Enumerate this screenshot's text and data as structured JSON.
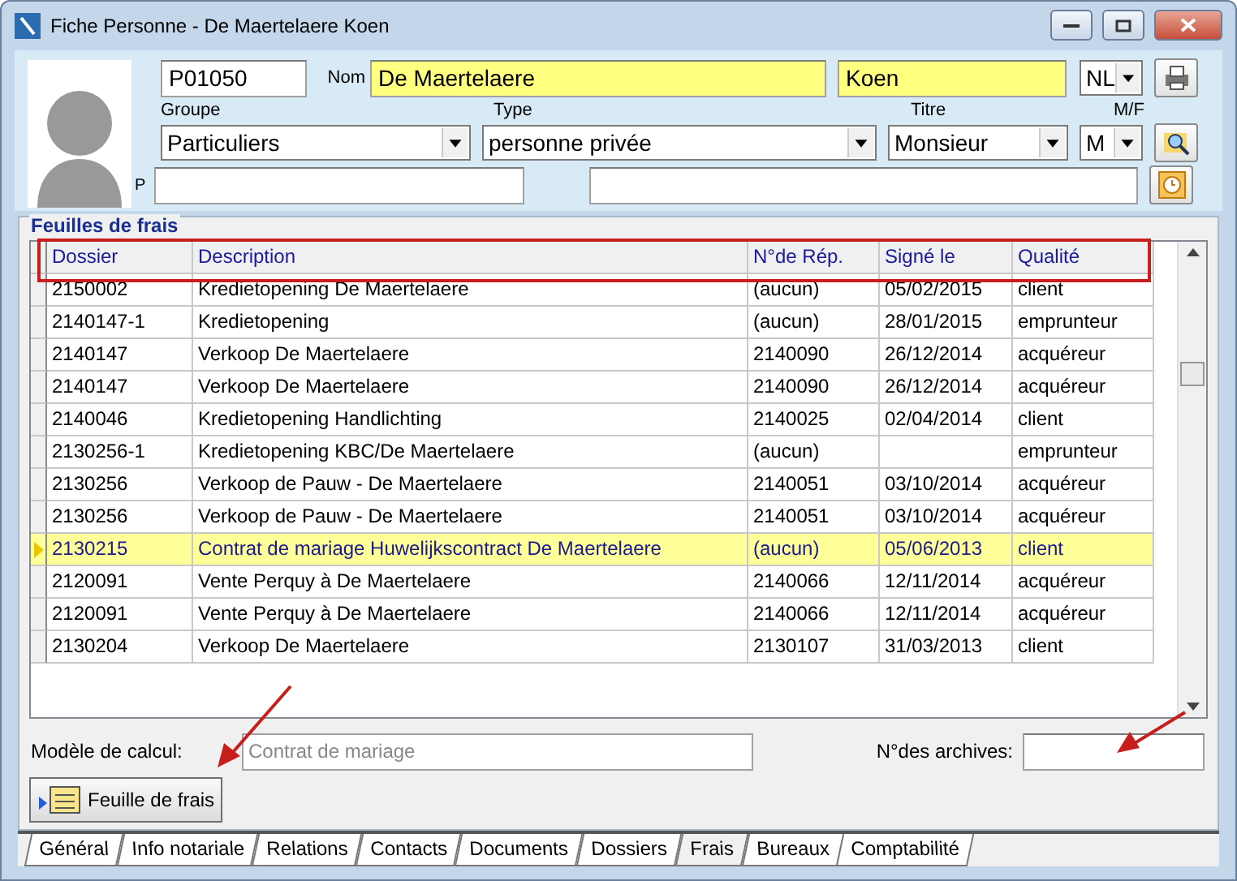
{
  "window": {
    "title": "Fiche Personne - De Maertelaere Koen"
  },
  "person": {
    "id": "P01050",
    "name_label": "Nom",
    "last_name": "De Maertelaere",
    "first_name": "Koen",
    "language": "NL",
    "group_label": "Groupe",
    "group": "Particuliers",
    "type_label": "Type",
    "type": "personne privée",
    "title_label": "Titre",
    "title": "Monsieur",
    "sex_label": "M/F",
    "sex": "M",
    "p_label": "P"
  },
  "expenses": {
    "title": "Feuilles de frais",
    "columns": [
      "Dossier",
      "Description",
      "N°de Rép.",
      "Signé le",
      "Qualité"
    ],
    "rows": [
      {
        "cells": [
          "2150002",
          "Kredietopening De Maertelaere",
          "(aucun)",
          "05/02/2015",
          "client"
        ],
        "selected": false
      },
      {
        "cells": [
          "2140147-1",
          "Kredietopening",
          "(aucun)",
          "28/01/2015",
          "emprunteur"
        ],
        "selected": false
      },
      {
        "cells": [
          "2140147",
          "Verkoop De Maertelaere",
          "2140090",
          "26/12/2014",
          "acquéreur"
        ],
        "selected": false
      },
      {
        "cells": [
          "2140147",
          "Verkoop De Maertelaere",
          "2140090",
          "26/12/2014",
          "acquéreur"
        ],
        "selected": false
      },
      {
        "cells": [
          "2140046",
          "Kredietopening Handlichting",
          "2140025",
          "02/04/2014",
          "client"
        ],
        "selected": false
      },
      {
        "cells": [
          "2130256-1",
          "Kredietopening KBC/De Maertelaere",
          "(aucun)",
          "",
          "emprunteur"
        ],
        "selected": false
      },
      {
        "cells": [
          "2130256",
          "Verkoop de Pauw - De Maertelaere",
          "2140051",
          "03/10/2014",
          "acquéreur"
        ],
        "selected": false
      },
      {
        "cells": [
          "2130256",
          "Verkoop de Pauw - De Maertelaere",
          "2140051",
          "03/10/2014",
          "acquéreur"
        ],
        "selected": false
      },
      {
        "cells": [
          "2130215",
          "Contrat de mariage Huwelijkscontract De Maertelaere",
          "(aucun)",
          "05/06/2013",
          "client"
        ],
        "selected": true
      },
      {
        "cells": [
          "2120091",
          "Vente Perquy à De Maertelaere",
          "2140066",
          "12/11/2014",
          "acquéreur"
        ],
        "selected": false
      },
      {
        "cells": [
          "2120091",
          "Vente Perquy à De Maertelaere",
          "2140066",
          "12/11/2014",
          "acquéreur"
        ],
        "selected": false
      },
      {
        "cells": [
          "2130204",
          "Verkoop De Maertelaere",
          "2130107",
          "31/03/2013",
          "client"
        ],
        "selected": false
      }
    ],
    "model_label": "Modèle de calcul:",
    "model": "Contrat de mariage",
    "model_disabled": true,
    "archives_label": "N°des archives:",
    "button": "Feuille de frais"
  },
  "tabs": [
    {
      "label": "Général",
      "selected": false
    },
    {
      "label": "Info notariale",
      "selected": false
    },
    {
      "label": "Relations",
      "selected": false
    },
    {
      "label": "Contacts",
      "selected": false
    },
    {
      "label": "Documents",
      "selected": false
    },
    {
      "label": "Dossiers",
      "selected": false
    },
    {
      "label": "Frais",
      "selected": true
    },
    {
      "label": "Bureaux",
      "selected": false
    },
    {
      "label": "Comptabilité",
      "selected": false
    }
  ]
}
